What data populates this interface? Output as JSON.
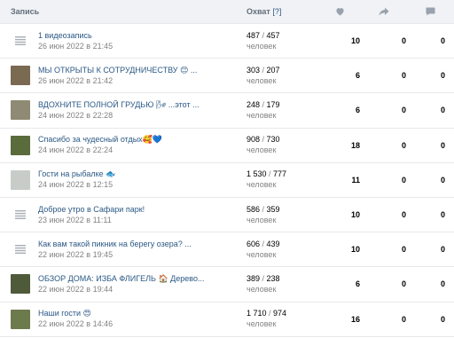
{
  "header": {
    "post": "Запись",
    "reach": "Охват",
    "reach_help": "[?]",
    "likes_icon": "heart-icon",
    "shares_icon": "share-arrow-icon",
    "comments_icon": "comment-bubble-icon"
  },
  "unit": "человек",
  "rows": [
    {
      "title": "1 видеозапись",
      "date": "26 июн 2022 в 21:45",
      "reach_total": "487",
      "reach_sub": "457",
      "likes": "10",
      "shares": "0",
      "comments": "0",
      "thumb": "text-lines-icon",
      "thumb_color": ""
    },
    {
      "title": "МЫ ОТКРЫТЫ К СОТРУДНИЧЕСТВУ 😊 ...",
      "date": "26 июн 2022 в 21:42",
      "reach_total": "303",
      "reach_sub": "207",
      "likes": "6",
      "shares": "0",
      "comments": "0",
      "thumb": "photo-thumbnail",
      "thumb_color": "#7a6a52"
    },
    {
      "title": "ВДОХНИТЕ ПОЛНОЙ ГРУДЬЮ 🌬 ...этот ...",
      "date": "24 июн 2022 в 22:28",
      "reach_total": "248",
      "reach_sub": "179",
      "likes": "6",
      "shares": "0",
      "comments": "0",
      "thumb": "photo-thumbnail",
      "thumb_color": "#8f8a73"
    },
    {
      "title": "Спасибо за чудесный отдых🥰💙",
      "date": "24 июн 2022 в 22:24",
      "reach_total": "908",
      "reach_sub": "730",
      "likes": "18",
      "shares": "0",
      "comments": "0",
      "thumb": "photo-thumbnail",
      "thumb_color": "#5a6b3c"
    },
    {
      "title": "Гости на рыбалке 🐟",
      "date": "24 июн 2022 в 12:15",
      "reach_total": "1 530",
      "reach_sub": "777",
      "likes": "11",
      "shares": "0",
      "comments": "0",
      "thumb": "photo-thumbnail",
      "thumb_color": "#c8ccc8"
    },
    {
      "title": "Доброе утро в Сафари парк!",
      "date": "23 июн 2022 в 11:11",
      "reach_total": "586",
      "reach_sub": "359",
      "likes": "10",
      "shares": "0",
      "comments": "0",
      "thumb": "text-lines-icon",
      "thumb_color": ""
    },
    {
      "title": "Как вам такой пикник на берегу озера? ...",
      "date": "22 июн 2022 в 19:45",
      "reach_total": "606",
      "reach_sub": "439",
      "likes": "10",
      "shares": "0",
      "comments": "0",
      "thumb": "text-lines-icon",
      "thumb_color": ""
    },
    {
      "title": "ОБЗОР ДОМА: ИЗБА ФЛИГЕЛЬ 🏠 Дерево...",
      "date": "22 июн 2022 в 19:44",
      "reach_total": "389",
      "reach_sub": "238",
      "likes": "6",
      "shares": "0",
      "comments": "0",
      "thumb": "photo-thumbnail",
      "thumb_color": "#4f5a3a"
    },
    {
      "title": "Наши гости 😍",
      "date": "22 июн 2022 в 14:46",
      "reach_total": "1 710",
      "reach_sub": "974",
      "likes": "16",
      "shares": "0",
      "comments": "0",
      "thumb": "photo-thumbnail",
      "thumb_color": "#6d7a4c"
    }
  ]
}
